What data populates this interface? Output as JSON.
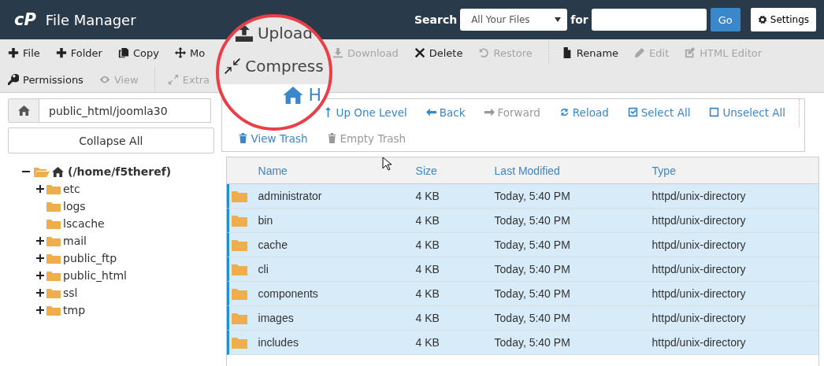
{
  "header": {
    "logo": "cP",
    "title": "File Manager",
    "search_label": "Search",
    "search_scope": "All Your Files",
    "for_label": "for",
    "go": "Go",
    "settings": "Settings"
  },
  "toolbar": {
    "row_1": [
      {
        "label": "File",
        "disabled": false
      },
      {
        "label": "Folder",
        "disabled": false
      },
      {
        "label": "Copy",
        "disabled": false
      },
      {
        "label": "Mo",
        "disabled": false
      },
      {
        "label": "Download",
        "disabled": true
      },
      {
        "label": "Delete",
        "disabled": false
      },
      {
        "label": "Restore",
        "disabled": true
      },
      {
        "label": "Rename",
        "disabled": false
      },
      {
        "label": "Edit",
        "disabled": true
      },
      {
        "label": "HTML Editor",
        "disabled": true
      }
    ],
    "row_2": [
      {
        "label": "Permissions",
        "disabled": false
      },
      {
        "label": "View",
        "disabled": true
      },
      {
        "label": "Extra",
        "disabled": true
      }
    ]
  },
  "magnifier": {
    "upload": "Upload",
    "compress": "Compress",
    "home": "H"
  },
  "path_field": {
    "value": "public_html/joomla30"
  },
  "collapse_all": "Collapse All",
  "tree": {
    "label": "(/home/f5theref)",
    "expanded": true,
    "children": [
      {
        "label": "etc",
        "expandable": true
      },
      {
        "label": "logs",
        "expandable": false
      },
      {
        "label": "lscache",
        "expandable": false
      },
      {
        "label": "mail",
        "expandable": true
      },
      {
        "label": "public_ftp",
        "expandable": true
      },
      {
        "label": "public_html",
        "expandable": true
      },
      {
        "label": "ssl",
        "expandable": true
      },
      {
        "label": "tmp",
        "expandable": true
      }
    ]
  },
  "nav": {
    "row_1": [
      {
        "label": "Up One Level",
        "disabled": false
      },
      {
        "label": "Back",
        "disabled": false
      },
      {
        "label": "Forward",
        "disabled": true
      },
      {
        "label": "Reload",
        "disabled": false
      },
      {
        "label": "Select All",
        "disabled": false
      },
      {
        "label": "Unselect All",
        "disabled": false
      }
    ],
    "row_2": [
      {
        "label": "View Trash",
        "disabled": false
      },
      {
        "label": "Empty Trash",
        "disabled": true
      }
    ]
  },
  "table": {
    "columns": [
      "Name",
      "Size",
      "Last Modified",
      "Type"
    ],
    "rows": [
      {
        "name": "administrator",
        "size": "4 KB",
        "modified": "Today, 5:40 PM",
        "type": "httpd/unix-directory",
        "selected": true
      },
      {
        "name": "bin",
        "size": "4 KB",
        "modified": "Today, 5:40 PM",
        "type": "httpd/unix-directory",
        "selected": true
      },
      {
        "name": "cache",
        "size": "4 KB",
        "modified": "Today, 5:40 PM",
        "type": "httpd/unix-directory",
        "selected": true
      },
      {
        "name": "cli",
        "size": "4 KB",
        "modified": "Today, 5:40 PM",
        "type": "httpd/unix-directory",
        "selected": true
      },
      {
        "name": "components",
        "size": "4 KB",
        "modified": "Today, 5:40 PM",
        "type": "httpd/unix-directory",
        "selected": true
      },
      {
        "name": "images",
        "size": "4 KB",
        "modified": "Today, 5:40 PM",
        "type": "httpd/unix-directory",
        "selected": true
      },
      {
        "name": "includes",
        "size": "4 KB",
        "modified": "Today, 5:40 PM",
        "type": "httpd/unix-directory",
        "selected": true
      }
    ]
  }
}
